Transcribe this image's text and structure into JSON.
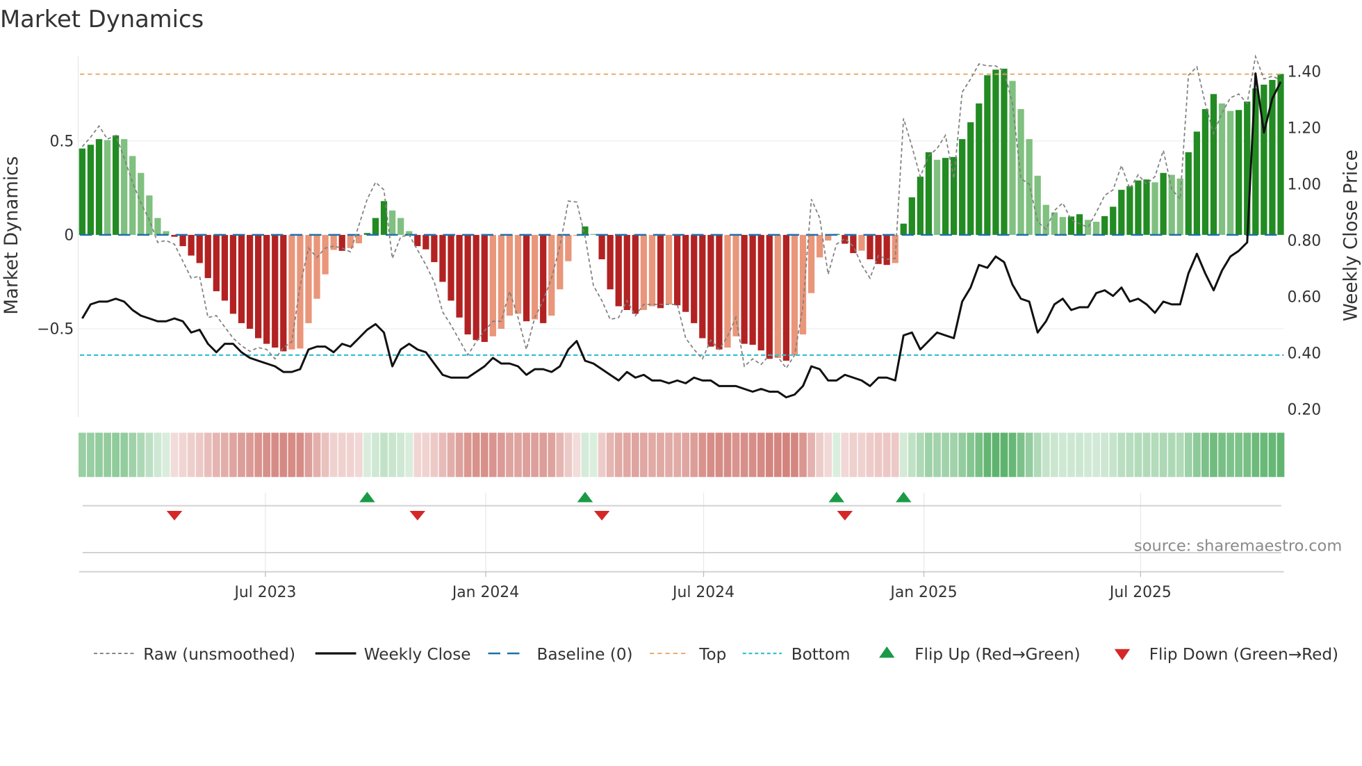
{
  "chart_data": {
    "type": "bar",
    "title": "Market Dynamics",
    "ylabel": "Market Dynamics",
    "ylabel_right": "Weekly Close Price",
    "xlabel": "",
    "frequency": "weekly",
    "start_date": "2023-01-29",
    "ylim": [
      -0.97,
      0.95
    ],
    "ylim_right": [
      0.17,
      1.45
    ],
    "yticks": [
      {
        "value": 0.5,
        "label": "0.5"
      },
      {
        "value": 0,
        "label": "0"
      },
      {
        "value": -0.5,
        "label": "−0.5"
      }
    ],
    "yticks_right": [
      {
        "value": 1.4,
        "label": "1.40"
      },
      {
        "value": 1.2,
        "label": "1.20"
      },
      {
        "value": 1.0,
        "label": "1.00"
      },
      {
        "value": 0.8,
        "label": "0.80"
      },
      {
        "value": 0.6,
        "label": "0.60"
      },
      {
        "value": 0.4,
        "label": "0.40"
      },
      {
        "value": 0.2,
        "label": "0.20"
      }
    ],
    "xticks": [
      {
        "date": "2023-07-01",
        "label": "Jul 2023"
      },
      {
        "date": "2024-01-01",
        "label": "Jan 2024"
      },
      {
        "date": "2024-07-01",
        "label": "Jul 2024"
      },
      {
        "date": "2025-01-01",
        "label": "Jan 2025"
      },
      {
        "date": "2025-07-01",
        "label": "Jul 2025"
      }
    ],
    "grid": true,
    "top_level": 0.856,
    "bottom_level": -0.64,
    "baseline": 0,
    "series": [
      {
        "name": "Market Dynamics",
        "kind": "bar",
        "values": [
          0.46,
          0.48,
          0.51,
          0.505,
          0.53,
          0.51,
          0.42,
          0.33,
          0.21,
          0.09,
          0.02,
          -0.01,
          -0.06,
          -0.11,
          -0.15,
          -0.23,
          -0.3,
          -0.35,
          -0.42,
          -0.47,
          -0.5,
          -0.55,
          -0.58,
          -0.6,
          -0.62,
          -0.61,
          -0.605,
          -0.47,
          -0.34,
          -0.21,
          -0.08,
          -0.085,
          -0.07,
          -0.045,
          0.01,
          0.09,
          0.18,
          0.13,
          0.09,
          0.02,
          -0.06,
          -0.077,
          -0.145,
          -0.25,
          -0.35,
          -0.44,
          -0.53,
          -0.56,
          -0.57,
          -0.54,
          -0.5,
          -0.43,
          -0.42,
          -0.46,
          -0.45,
          -0.47,
          -0.43,
          -0.29,
          -0.14,
          -0.005,
          0.045,
          0.005,
          -0.13,
          -0.29,
          -0.38,
          -0.4,
          -0.42,
          -0.4,
          -0.38,
          -0.39,
          -0.37,
          -0.375,
          -0.41,
          -0.47,
          -0.55,
          -0.595,
          -0.61,
          -0.6,
          -0.54,
          -0.58,
          -0.585,
          -0.615,
          -0.66,
          -0.655,
          -0.67,
          -0.64,
          -0.53,
          -0.31,
          -0.12,
          -0.03,
          0.005,
          -0.047,
          -0.097,
          -0.084,
          -0.13,
          -0.155,
          -0.16,
          -0.15,
          0.06,
          0.2,
          0.31,
          0.44,
          0.4,
          0.41,
          0.415,
          0.51,
          0.6,
          0.7,
          0.85,
          0.88,
          0.885,
          0.82,
          0.67,
          0.51,
          0.315,
          0.16,
          0.12,
          0.095,
          0.098,
          0.11,
          0.08,
          0.07,
          0.1,
          0.15,
          0.24,
          0.26,
          0.29,
          0.295,
          0.28,
          0.33,
          0.32,
          0.3,
          0.44,
          0.55,
          0.67,
          0.75,
          0.7,
          0.66,
          0.665,
          0.71,
          0.78,
          0.8,
          0.825,
          0.857
        ]
      },
      {
        "name": "Raw (unsmoothed)",
        "kind": "line",
        "axis": "left",
        "values": [
          0.47,
          0.52,
          0.58,
          0.51,
          0.53,
          0.41,
          0.28,
          0.17,
          0.08,
          -0.04,
          -0.03,
          -0.05,
          -0.14,
          -0.23,
          -0.22,
          -0.44,
          -0.43,
          -0.49,
          -0.55,
          -0.59,
          -0.62,
          -0.6,
          -0.61,
          -0.66,
          -0.6,
          -0.57,
          -0.27,
          -0.07,
          -0.12,
          -0.07,
          -0.06,
          -0.07,
          -0.09,
          0.05,
          0.19,
          0.28,
          0.24,
          -0.125,
          -0.01,
          0,
          -0.08,
          -0.16,
          -0.25,
          -0.41,
          -0.48,
          -0.56,
          -0.64,
          -0.57,
          -0.51,
          -0.46,
          -0.46,
          -0.3,
          -0.44,
          -0.61,
          -0.44,
          -0.35,
          -0.23,
          -0.06,
          0.18,
          0.175,
          -0.01,
          -0.27,
          -0.35,
          -0.45,
          -0.44,
          -0.35,
          -0.43,
          -0.37,
          -0.37,
          -0.37,
          -0.37,
          -0.37,
          -0.55,
          -0.61,
          -0.66,
          -0.56,
          -0.61,
          -0.54,
          -0.44,
          -0.7,
          -0.66,
          -0.69,
          -0.64,
          -0.65,
          -0.71,
          -0.64,
          -0.38,
          0.19,
          0.09,
          -0.21,
          -0.05,
          -0.02,
          -0.06,
          -0.16,
          -0.23,
          -0.11,
          -0.13,
          -0.125,
          0.62,
          0.47,
          0.31,
          0.42,
          0.46,
          0.53,
          0.3,
          0.76,
          0.83,
          0.91,
          0.9,
          0.9,
          0.87,
          0.7,
          0.3,
          0.27,
          0.07,
          0.03,
          0.13,
          0.17,
          0.08,
          0.06,
          0.04,
          0.12,
          0.21,
          0.24,
          0.37,
          0.245,
          0.32,
          0.27,
          0.31,
          0.45,
          0.245,
          0.19,
          0.85,
          0.895,
          0.7,
          0.54,
          0.65,
          0.73,
          0.75,
          0.7,
          0.95,
          0.83,
          0.845,
          0.825
        ]
      },
      {
        "name": "Weekly Close",
        "kind": "line",
        "axis": "right",
        "values": [
          0.52,
          0.57,
          0.58,
          0.58,
          0.59,
          0.58,
          0.55,
          0.53,
          0.52,
          0.51,
          0.51,
          0.52,
          0.51,
          0.47,
          0.48,
          0.43,
          0.4,
          0.43,
          0.43,
          0.4,
          0.38,
          0.37,
          0.36,
          0.35,
          0.33,
          0.33,
          0.34,
          0.41,
          0.42,
          0.42,
          0.4,
          0.43,
          0.42,
          0.45,
          0.48,
          0.5,
          0.47,
          0.35,
          0.41,
          0.43,
          0.41,
          0.4,
          0.36,
          0.32,
          0.31,
          0.31,
          0.31,
          0.33,
          0.35,
          0.38,
          0.36,
          0.36,
          0.35,
          0.32,
          0.34,
          0.34,
          0.33,
          0.35,
          0.41,
          0.44,
          0.37,
          0.36,
          0.34,
          0.32,
          0.3,
          0.33,
          0.31,
          0.32,
          0.3,
          0.3,
          0.29,
          0.3,
          0.29,
          0.31,
          0.3,
          0.3,
          0.28,
          0.28,
          0.28,
          0.27,
          0.26,
          0.27,
          0.26,
          0.26,
          0.24,
          0.25,
          0.28,
          0.35,
          0.34,
          0.3,
          0.3,
          0.32,
          0.31,
          0.3,
          0.28,
          0.31,
          0.31,
          0.3,
          0.46,
          0.47,
          0.41,
          0.44,
          0.47,
          0.46,
          0.45,
          0.58,
          0.63,
          0.71,
          0.7,
          0.74,
          0.72,
          0.64,
          0.59,
          0.58,
          0.47,
          0.51,
          0.57,
          0.59,
          0.55,
          0.56,
          0.56,
          0.61,
          0.62,
          0.6,
          0.63,
          0.58,
          0.59,
          0.57,
          0.54,
          0.58,
          0.57,
          0.57,
          0.68,
          0.75,
          0.68,
          0.62,
          0.69,
          0.74,
          0.76,
          0.79,
          1.39,
          1.18,
          1.3,
          1.36
        ]
      }
    ],
    "flips_up": [
      34,
      60,
      90,
      98
    ],
    "flips_down": [
      11,
      40,
      62,
      91
    ],
    "colors": {
      "green_strong": "#228b22",
      "green_weak": "#80c080",
      "red_strong": "#b22222",
      "red_weak": "#e9967a",
      "raw": "#808080",
      "close": "#111111",
      "baseline": "#1f6fa8",
      "top": "#e8a862",
      "bottom": "#3cc0d0",
      "flip_up": "#1a9a46",
      "flip_down": "#d62728",
      "heat_green": "#5cb26c",
      "heat_red": "#c8645c"
    },
    "legend": {
      "position": "bottom",
      "items": [
        {
          "key": "raw",
          "label": "Raw (unsmoothed)"
        },
        {
          "key": "close",
          "label": "Weekly Close"
        },
        {
          "key": "baseline",
          "label": "Baseline (0)"
        },
        {
          "key": "top",
          "label": "Top"
        },
        {
          "key": "bottom",
          "label": "Bottom"
        },
        {
          "key": "flip_up",
          "label": "Flip Up (Red→Green)"
        },
        {
          "key": "flip_down",
          "label": "Flip Down (Green→Red)"
        }
      ]
    },
    "source": "source: sharemaestro.com"
  }
}
